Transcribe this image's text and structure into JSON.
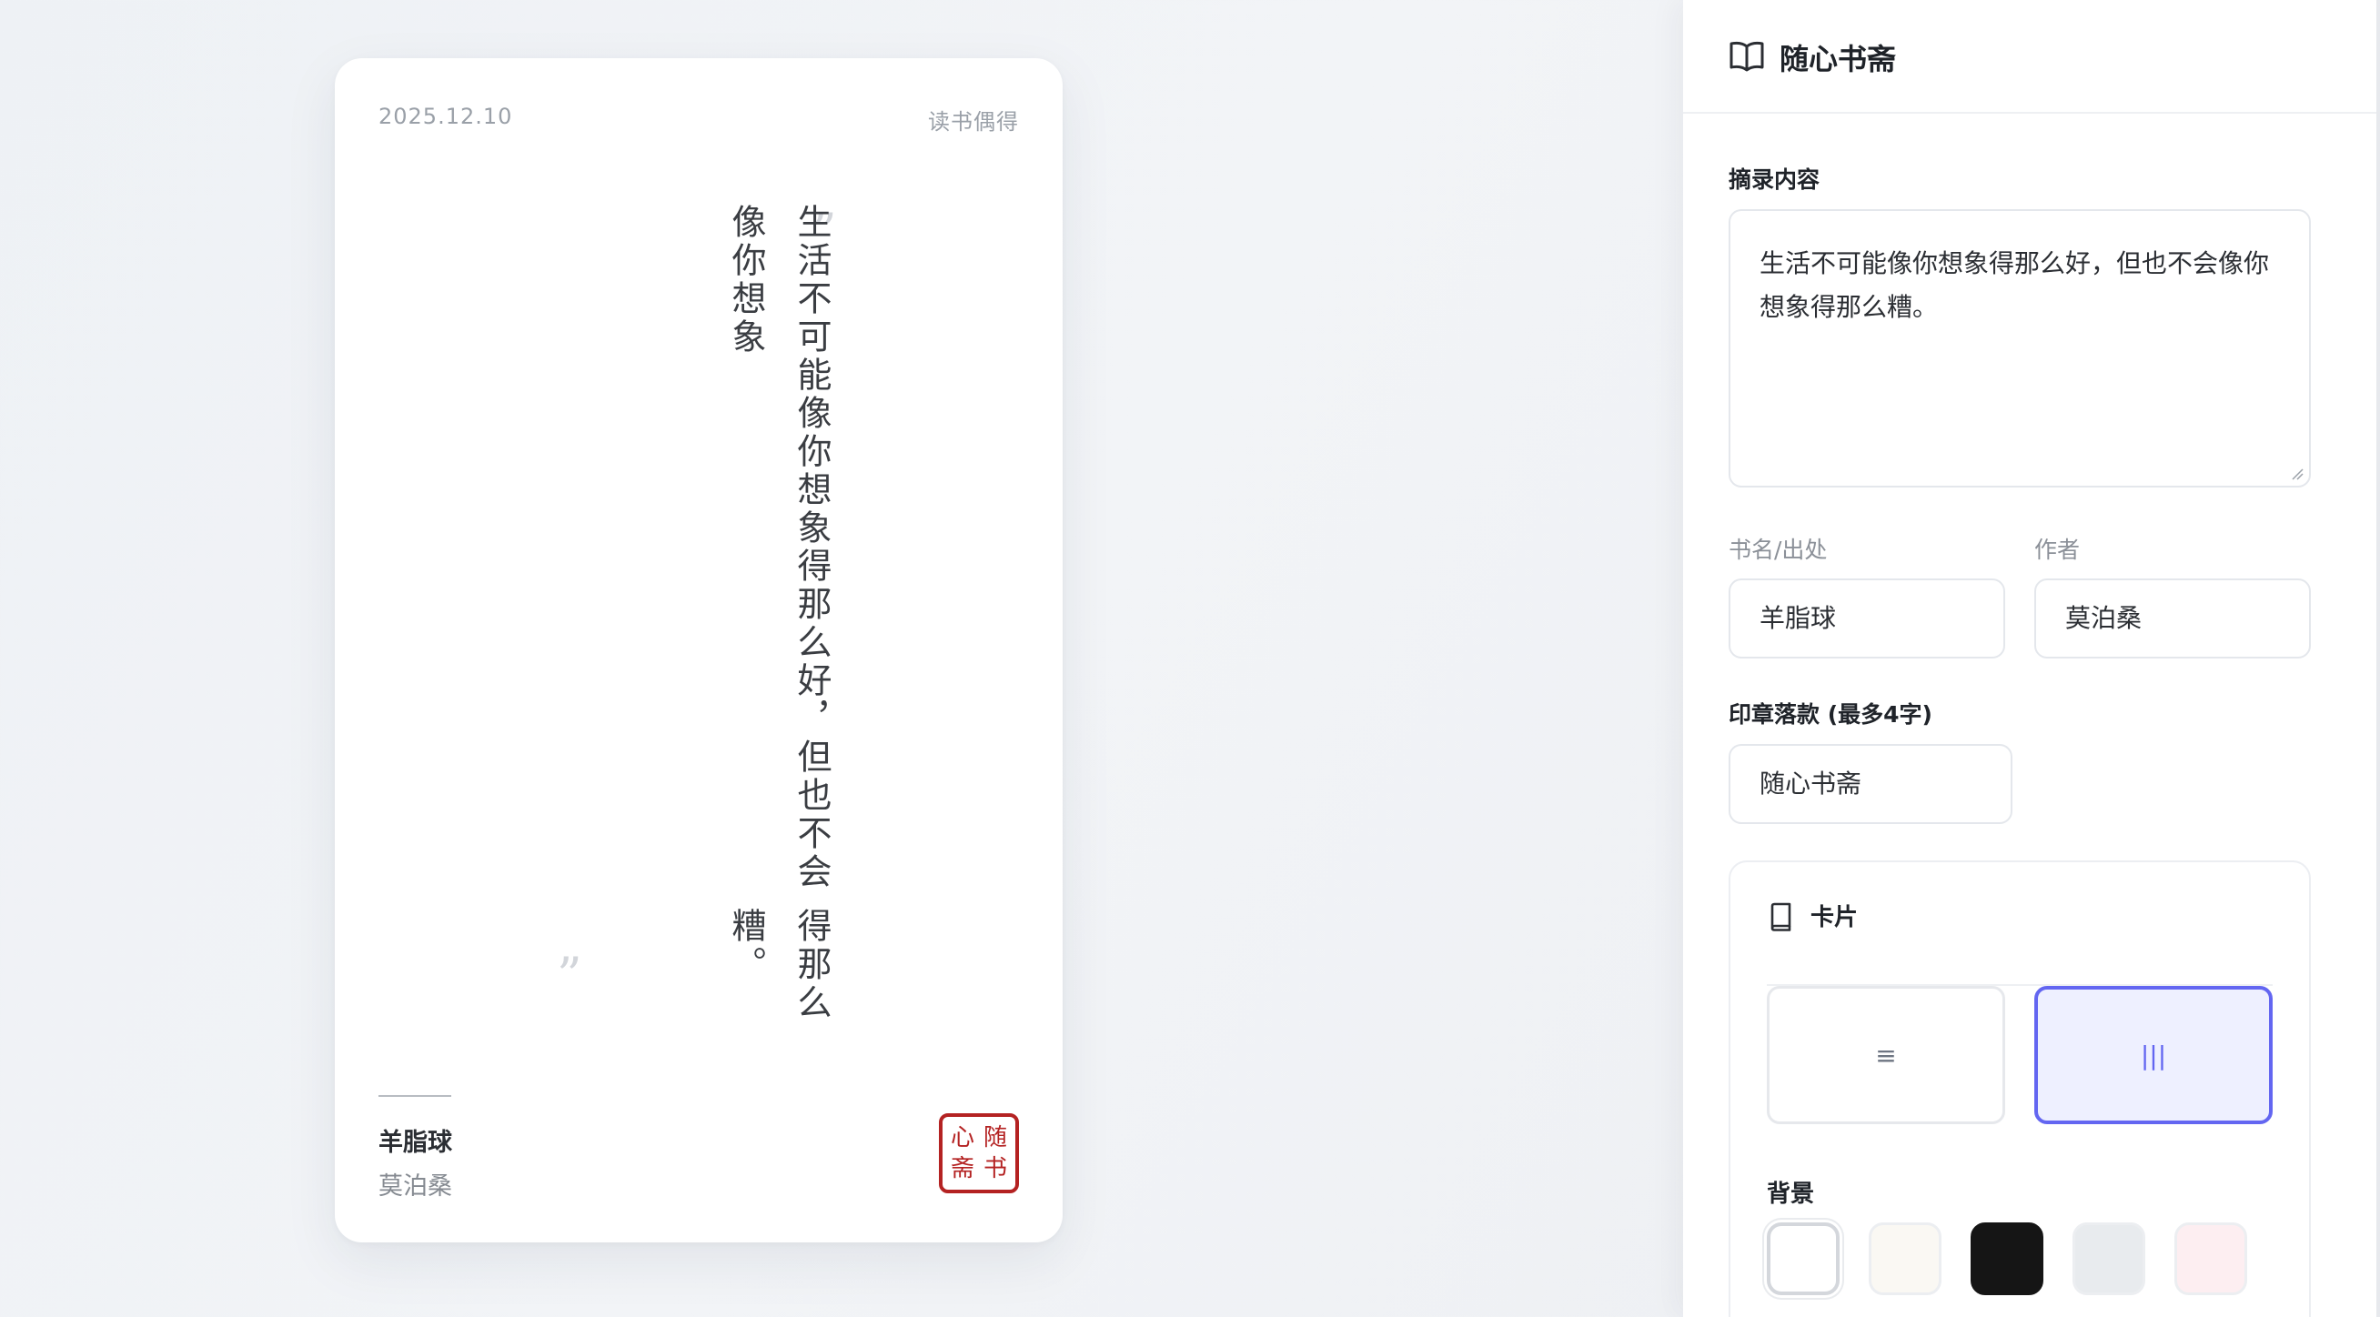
{
  "card": {
    "date": "2025.12.10",
    "tag": "读书偶得",
    "quote_open": "”",
    "quote_close": "”",
    "quote_lines": [
      "生活不可能像你想象得那么好，但也不会像你想象",
      "得那么糟。"
    ],
    "book": "羊脂球",
    "author": "莫泊桑",
    "seal_chars": [
      "随",
      "心",
      "书",
      "斋"
    ]
  },
  "panel": {
    "brand_icon": "open-book-icon",
    "title": "随心书斋",
    "excerpt": {
      "label": "摘录内容",
      "value": "生活不可能像你想象得那么好，但也不会像你想象得那么糟。"
    },
    "book_field": {
      "label": "书名/出处",
      "value": "羊脂球"
    },
    "author_field": {
      "label": "作者",
      "value": "莫泊桑"
    },
    "seal_field": {
      "label": "印章落款 (最多4字)",
      "value": "随心书斋"
    },
    "card_section": {
      "icon": "book-icon",
      "title": "卡片",
      "layouts": [
        {
          "name": "horizontal",
          "glyph": "≡",
          "selected": false
        },
        {
          "name": "vertical",
          "glyph": "|||",
          "selected": true
        }
      ],
      "background_label": "背景",
      "backgrounds": [
        {
          "color": "#ffffff",
          "selected": true
        },
        {
          "color": "#faf8f3",
          "selected": false
        },
        {
          "color": "#151515",
          "selected": false
        },
        {
          "color": "#e8ebee",
          "selected": false
        },
        {
          "color": "#fdeef1",
          "selected": false
        }
      ]
    }
  },
  "colors": {
    "accent": "#6366f1",
    "seal_red": "#b42222"
  }
}
